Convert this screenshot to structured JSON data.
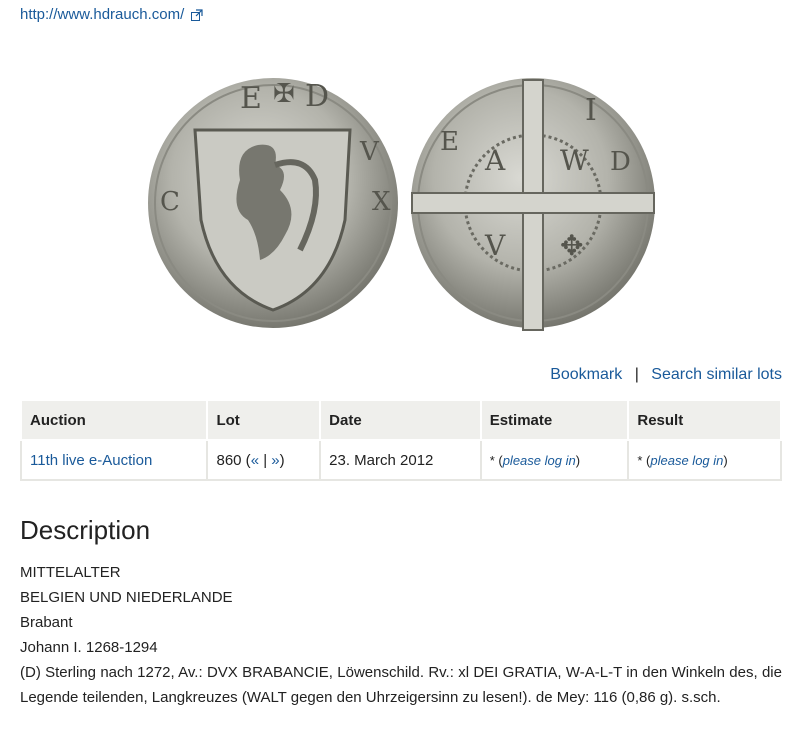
{
  "top_link": {
    "url_text": "http://www.hdrauch.com/"
  },
  "actions": {
    "bookmark": "Bookmark",
    "separator": "|",
    "search_similar": "Search similar lots"
  },
  "table": {
    "headers": [
      "Auction",
      "Lot",
      "Date",
      "Estimate",
      "Result"
    ],
    "row": {
      "auction": "11th live e-Auction",
      "lot_number": "860",
      "lot_prev": "«",
      "lot_sep": "|",
      "lot_next": "»",
      "date": "23. March 2012",
      "estimate_star": "* ",
      "estimate_link": "please log in",
      "result_star": "* ",
      "result_link": "please log in"
    }
  },
  "description": {
    "title": "Description",
    "lines": [
      "MITTELALTER",
      "BELGIEN UND NIEDERLANDE",
      "Brabant",
      "Johann I. 1268-1294",
      "(D) Sterling nach 1272, Av.: DVX BRABANCIE, Löwenschild. Rv.: xl DEI GRATIA, W-A-L-T in den Winkeln des, die Legende teilenden, Langkreuzes (WALT gegen den Uhrzeigersinn zu lesen!). de Mey: 116 (0,86 g). s.sch."
    ]
  },
  "colors": {
    "link": "#1a5a9a",
    "header_bg": "#efefec"
  }
}
